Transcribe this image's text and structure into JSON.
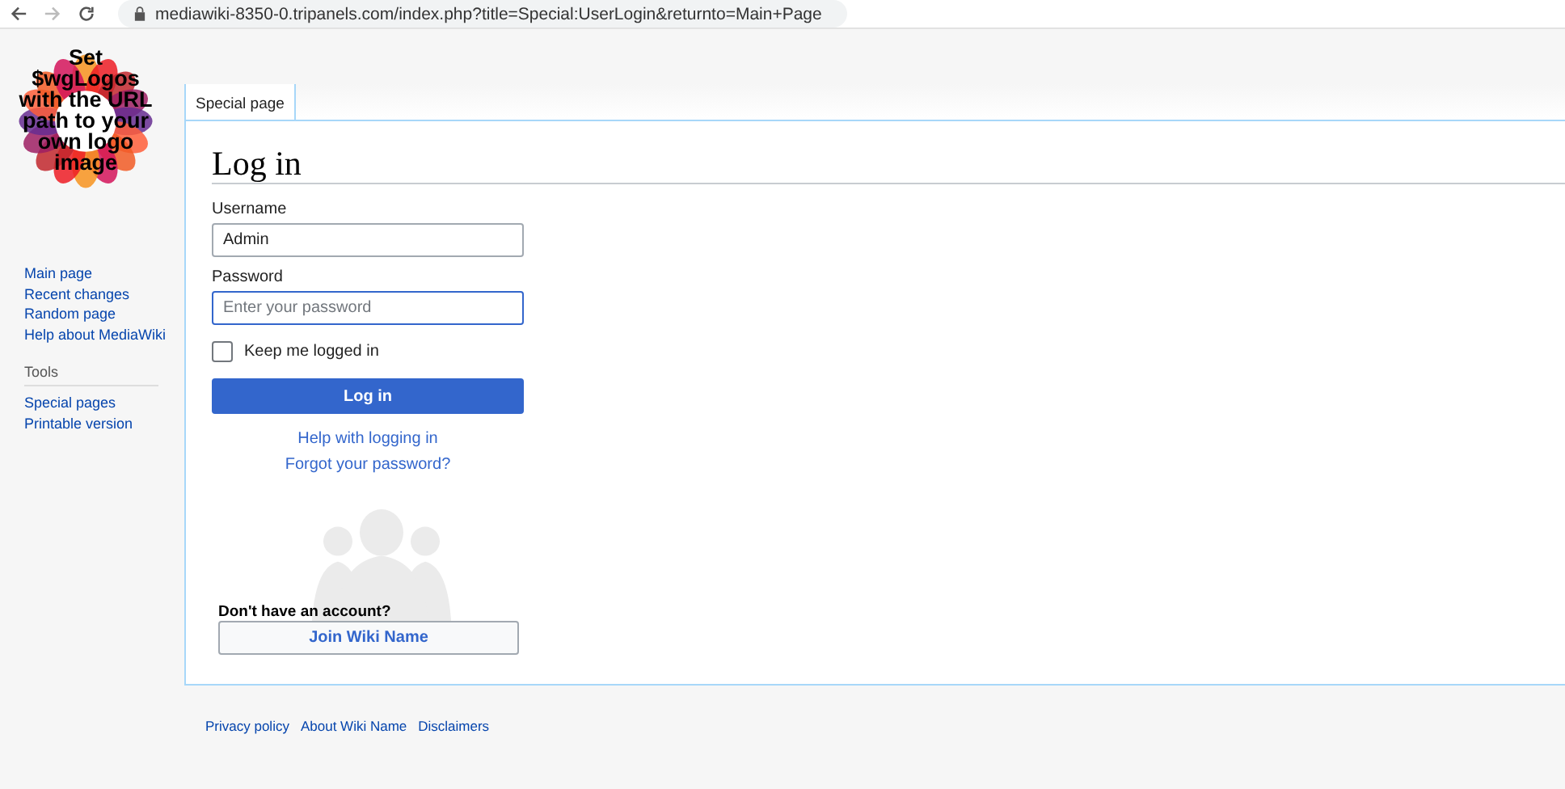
{
  "browser": {
    "url": "mediawiki-8350-0.tripanels.com/index.php?title=Special:UserLogin&returnto=Main+Page"
  },
  "logo": {
    "text": "Set $wgLogos with the URL path to your own logo image"
  },
  "sidebar": {
    "navigation": [
      "Main page",
      "Recent changes",
      "Random page",
      "Help about MediaWiki"
    ],
    "tools_heading": "Tools",
    "tools": [
      "Special pages",
      "Printable version"
    ]
  },
  "tabs": [
    {
      "label": "Special page",
      "selected": true
    }
  ],
  "page": {
    "title": "Log in",
    "username": {
      "label": "Username",
      "value": "Admin"
    },
    "password": {
      "label": "Password",
      "placeholder": "Enter your password",
      "focused": true
    },
    "remember": {
      "label": "Keep me logged in",
      "checked": false
    },
    "submit": "Log in",
    "links": [
      "Help with logging in",
      "Forgot your password?"
    ],
    "signup": {
      "question": "Don't have an account?",
      "button": "Join Wiki Name"
    }
  },
  "footer": [
    "Privacy policy",
    "About Wiki Name",
    "Disclaimers"
  ]
}
